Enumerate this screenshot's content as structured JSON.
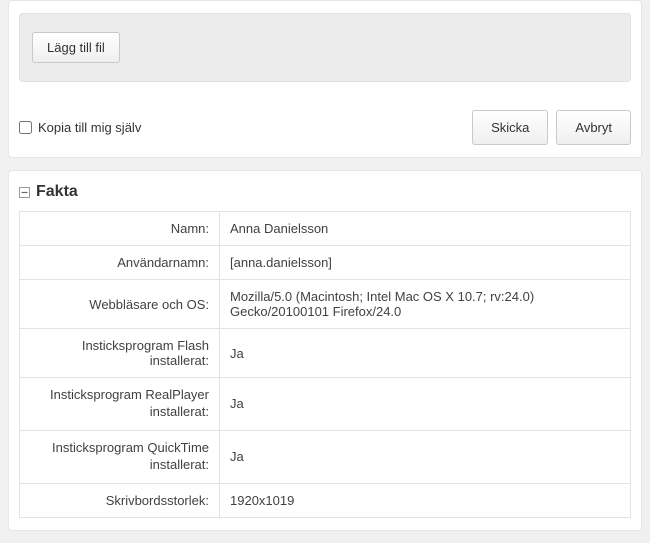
{
  "upload": {
    "add_file_label": "Lägg till fil"
  },
  "actions": {
    "copy_to_self_label": "Kopia till mig själv",
    "send_label": "Skicka",
    "cancel_label": "Avbryt"
  },
  "facts": {
    "title": "Fakta",
    "rows": [
      {
        "label": "Namn:",
        "value": "Anna Danielsson"
      },
      {
        "label": "Användarnamn:",
        "value": "[anna.danielsson]"
      },
      {
        "label": "Webbläsare och OS:",
        "value": "Mozilla/5.0 (Macintosh; Intel Mac OS X 10.7; rv:24.0) Gecko/20100101 Firefox/24.0"
      },
      {
        "label": "Insticksprogram Flash installerat:",
        "value": "Ja"
      },
      {
        "label": "Insticksprogram RealPlayer installerat:",
        "value": "Ja"
      },
      {
        "label": "Insticksprogram QuickTime installerat:",
        "value": "Ja"
      },
      {
        "label": "Skrivbordsstorlek:",
        "value": "1920x1019"
      }
    ]
  }
}
